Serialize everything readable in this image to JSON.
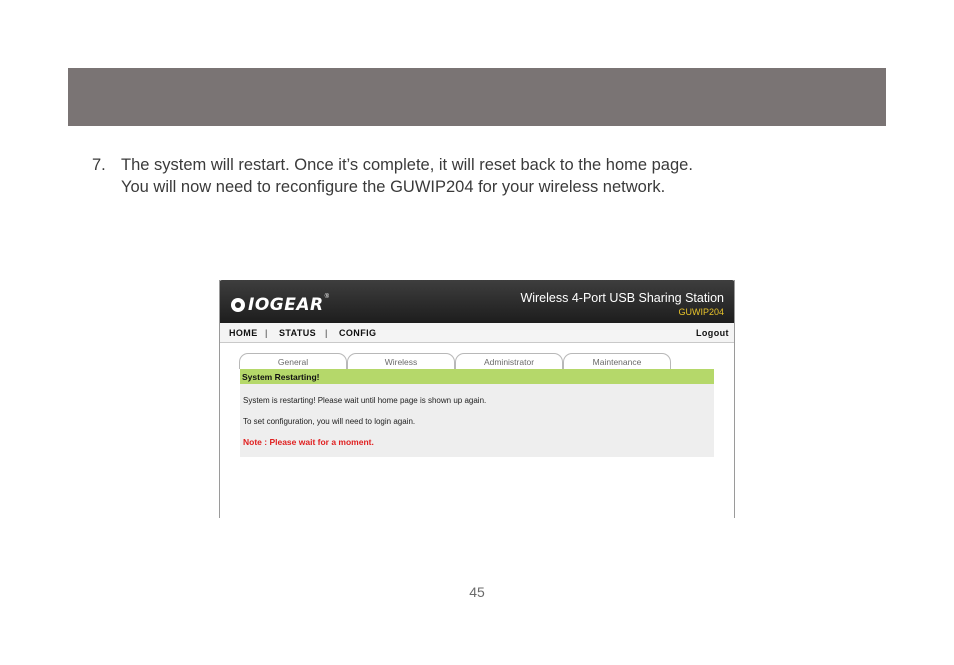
{
  "step": {
    "number": "7.",
    "line1": "The system will restart. Once it’s complete, it will reset back to the home page.",
    "line2": "You will now need to reconfigure the GUWIP204 for your wireless network."
  },
  "screenshot": {
    "header": {
      "logo_text": "IOGEAR",
      "logo_reg": "®",
      "product_title": "Wireless 4-Port USB Sharing Station",
      "model": "GUWIP204"
    },
    "nav": {
      "home": "HOME",
      "status": "STATUS",
      "config": "CONFIG",
      "separator": "|",
      "logout": "Logout"
    },
    "tabs": [
      "General",
      "Wireless",
      "Administrator",
      "Maintenance"
    ],
    "panel": {
      "heading": "System Restarting!",
      "message1": "System is restarting! Please wait until home page is shown up again.",
      "message2": "To set configuration, you will need to login again.",
      "note": "Note : Please wait for a moment."
    }
  },
  "page_number": "45",
  "colors": {
    "top_bar": "#7a7474",
    "panel_heading": "#b5d86a",
    "model_text": "#e8c32a",
    "note_text": "#e02020"
  }
}
